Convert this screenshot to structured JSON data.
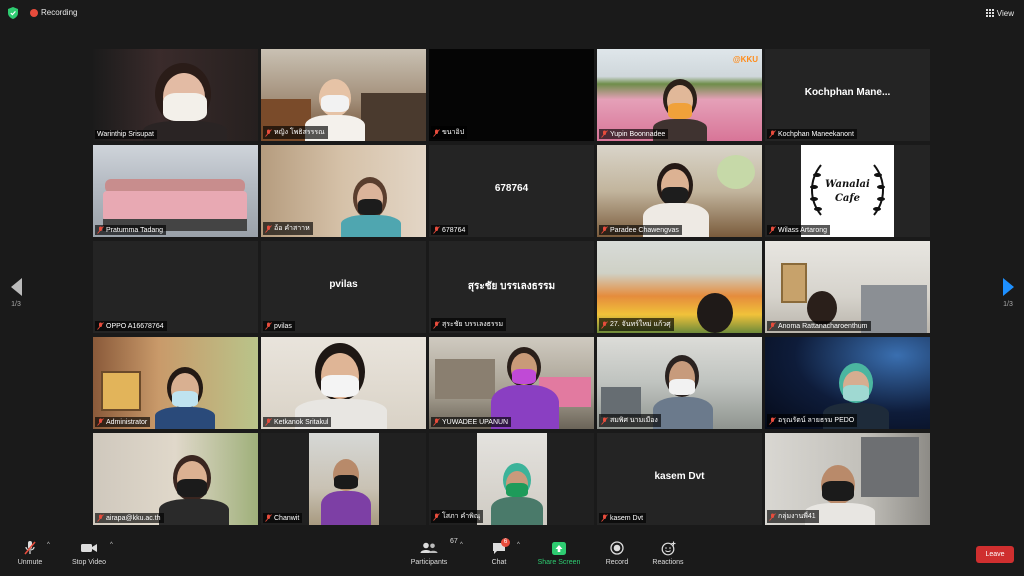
{
  "topbar": {
    "recording_label": "Recording",
    "view_label": "View",
    "shield_color": "#2ecc71"
  },
  "navigation": {
    "left_page": "1/3",
    "right_page": "1/3"
  },
  "tiles": [
    {
      "name": "Warinthip Srisupat",
      "center": "",
      "muted": false,
      "active": true
    },
    {
      "name": "หญิง โพธิสรรรณ",
      "center": "",
      "muted": true,
      "active": false
    },
    {
      "name": "ขนาอิป",
      "center": "",
      "muted": true,
      "active": false
    },
    {
      "name": "Yupin Boonnadee",
      "center": "",
      "muted": true,
      "active": false
    },
    {
      "name": "Kochphan Maneekanont",
      "center": "Kochphan  Mane...",
      "muted": true,
      "active": false
    },
    {
      "name": "Pratumma Tadang",
      "center": "",
      "muted": true,
      "active": false
    },
    {
      "name": "อ้อ คำสาาห",
      "center": "",
      "muted": true,
      "active": false
    },
    {
      "name": "678764",
      "center": "678764",
      "muted": true,
      "active": false
    },
    {
      "name": "Paradee Chawengvas",
      "center": "",
      "muted": true,
      "active": false
    },
    {
      "name": "Wilass Artarong",
      "center": "",
      "muted": true,
      "active": false
    },
    {
      "name": "OPPO A16678764",
      "center": "",
      "muted": true,
      "active": false
    },
    {
      "name": "pvilas",
      "center": "pvilas",
      "muted": true,
      "active": false
    },
    {
      "name": "สุระชัย บรรเลงธรรม",
      "center": "สุระชัย บรรเลงธรรม",
      "muted": true,
      "active": false
    },
    {
      "name": "27. จันทร์ใหม่ แก้วศุ",
      "center": "",
      "muted": true,
      "active": false
    },
    {
      "name": "Anoma Rattanacharoenthum",
      "center": "",
      "muted": true,
      "active": false
    },
    {
      "name": "Administrator",
      "center": "",
      "muted": true,
      "active": false
    },
    {
      "name": "Ketkanok Sritakul",
      "center": "",
      "muted": true,
      "active": false
    },
    {
      "name": "YUWADEE UPANUN",
      "center": "",
      "muted": true,
      "active": false
    },
    {
      "name": "สมพิศ นามเมือง",
      "center": "",
      "muted": true,
      "active": false
    },
    {
      "name": "อรุณรัตน์ ลายธรม PEDO",
      "center": "",
      "muted": true,
      "active": false
    },
    {
      "name": "airapa@kku.ac.th",
      "center": "",
      "muted": true,
      "active": false
    },
    {
      "name": "Chanwit",
      "center": "",
      "muted": true,
      "active": false
    },
    {
      "name": "โสภา คำพิณุ",
      "center": "",
      "muted": true,
      "active": false
    },
    {
      "name": "kasem Dvt",
      "center": "kasem Dvt",
      "muted": true,
      "active": false
    },
    {
      "name": "กลุ่มงานพี่41",
      "center": "",
      "muted": true,
      "active": false
    }
  ],
  "tile_extras": {
    "kku_watermark": "@KKU",
    "cafe_line1": "Wanalai",
    "cafe_line2": "Cafe"
  },
  "toolbar": {
    "unmute": "Unmute",
    "stop_video": "Stop Video",
    "participants": "Participants",
    "participants_count": "67",
    "chat": "Chat",
    "chat_badge": "6",
    "share_screen": "Share Screen",
    "record": "Record",
    "reactions": "Reactions",
    "leave": "Leave",
    "share_color": "#2ecc71",
    "leave_color": "#cf2f2f"
  }
}
